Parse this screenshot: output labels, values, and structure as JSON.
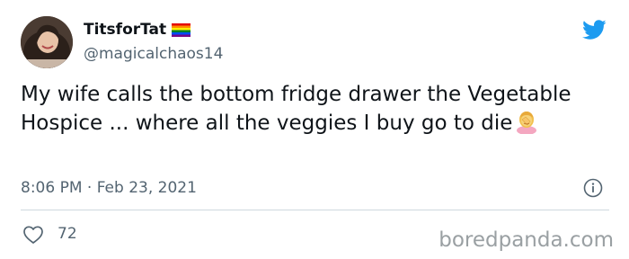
{
  "tweet": {
    "display_name": "TitsforTat",
    "handle": "@magicalchaos14",
    "text": "My wife calls the bottom fridge drawer the Vegetable Hospice ... where all the veggies I buy go to die",
    "timestamp": "8:06 PM · Feb 23, 2021",
    "likes": "72"
  },
  "icons": {
    "avatar": "avatar-photo",
    "flag": "rainbow-flag-icon",
    "brand": "twitter-bird-icon",
    "emoji": "woman-facepalming-emoji",
    "info": "info-icon",
    "like": "heart-icon"
  },
  "watermark": "boredpanda.com",
  "colors": {
    "twitter_blue": "#1d9bf0",
    "secondary_text": "#536471",
    "divider": "#cfd9de"
  }
}
